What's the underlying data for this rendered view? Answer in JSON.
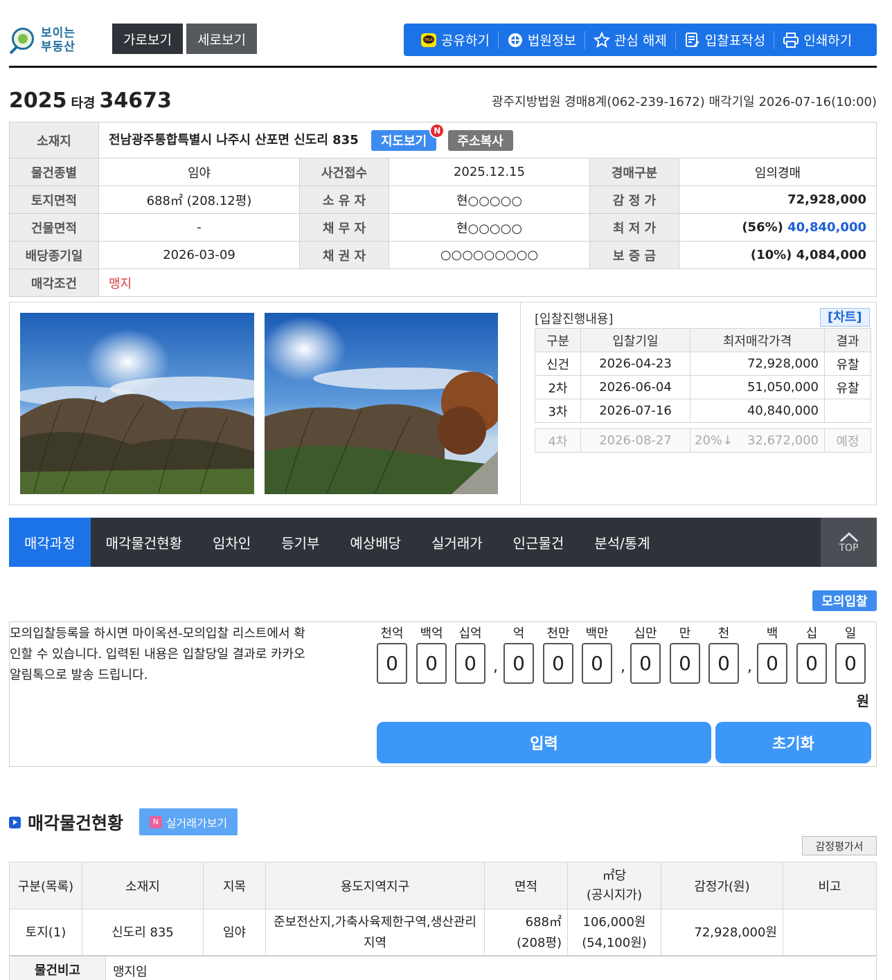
{
  "logo": {
    "line1": "보이는",
    "line2": "부동산"
  },
  "view": {
    "horizontal": "가로보기",
    "vertical": "세로보기"
  },
  "toolbar": {
    "share": "공유하기",
    "court_info": "법원정보",
    "unwatch": "관심 해제",
    "bid_form": "입찰표작성",
    "print": "인쇄하기"
  },
  "case": {
    "year": "2025",
    "type": "타경",
    "number": "34673"
  },
  "court_line": "광주지방법원 경매8계(062-239-1672) 매각기일 2026-07-16(10:00)",
  "info": {
    "address_label": "소재지",
    "address": "전남광주통합특별시 나주시 산포면 신도리 835",
    "map_btn": "지도보기",
    "map_badge": "N",
    "copy_btn": "주소복사",
    "rows": [
      {
        "l1": "물건종별",
        "v1": "임야",
        "l2": "사건접수",
        "v2": "2025.12.15",
        "l3": "경매구분",
        "v3": "임의경매"
      },
      {
        "l1": "토지면적",
        "v1": "688㎡ (208.12평)",
        "l2": "소 유 자",
        "v2": "현○○○○○",
        "l3": "감 정 가",
        "v3": "72,928,000"
      },
      {
        "l1": "건물면적",
        "v1": "-",
        "l2": "채 무 자",
        "v2": "현○○○○○",
        "l3": "최 저 가",
        "v3a": "(56%) ",
        "v3b": "40,840,000"
      },
      {
        "l1": "배당종기일",
        "v1": "2026-03-09",
        "l2": "채 권 자",
        "v2": "○○○○○○○○○",
        "l3": "보 증 금",
        "v3": "(10%) 4,084,000"
      }
    ],
    "cond_label": "매각조건",
    "cond_value": "맹지"
  },
  "bid": {
    "title": "[입찰진행내용]",
    "chart_btn": "[차트]",
    "headers": [
      "구분",
      "입찰기일",
      "최저매각가격",
      "결과"
    ],
    "rows": [
      {
        "round": "신건",
        "date": "2026-04-23",
        "price": "72,928,000",
        "result": "유찰"
      },
      {
        "round": "2차",
        "date": "2026-06-04",
        "price": "51,050,000",
        "result": "유찰"
      },
      {
        "round": "3차",
        "date": "2026-07-16",
        "price": "40,840,000",
        "result": ""
      }
    ],
    "next": {
      "round": "4차",
      "date": "2026-08-27",
      "rate": "20%↓",
      "price": "32,672,000",
      "result": "예정"
    }
  },
  "tabs": [
    "매각과정",
    "매각물건현황",
    "임차인",
    "등기부",
    "예상배당",
    "실거래가",
    "인근물건",
    "분석/통계"
  ],
  "top_label": "TOP",
  "mock": {
    "tag": "모의입찰",
    "text": "모의입찰등록을 하시면 마이옥션-모의입찰 리스트에서 확인할 수 있습니다. 입력된 내용은 입찰당일 결과로 카카오알림톡으로 발송 드립니다.",
    "units": [
      "천억",
      "백억",
      "십억",
      "억",
      "천만",
      "백만",
      "십만",
      "만",
      "천",
      "백",
      "십",
      "일"
    ],
    "digits": [
      "0",
      "0",
      "0",
      "0",
      "0",
      "0",
      "0",
      "0",
      "0",
      "0",
      "0",
      "0"
    ],
    "won": "원",
    "submit": "입력",
    "reset": "초기화"
  },
  "property": {
    "title": "매각물건현황",
    "real_btn_badge": "N",
    "real_btn": "실거래가보기",
    "appraisal_btn": "감정평가서",
    "headers": [
      "구분(목록)",
      "소재지",
      "지목",
      "용도지역지구",
      "면적",
      "㎡당",
      "(공시지가)",
      "감정가(원)",
      "비고"
    ],
    "row": {
      "kind": "토지(1)",
      "addr": "신도리 835",
      "jimok": "임야",
      "zone": "준보전산지,가축사육제한구역,생산관리지역",
      "area1": "688㎡",
      "area2": "(208평)",
      "unit1": "106,000원",
      "unit2": "(54,100원)",
      "appraisal": "72,928,000원",
      "note": ""
    },
    "note_label": "물건비고",
    "note_value": "맹지임"
  }
}
